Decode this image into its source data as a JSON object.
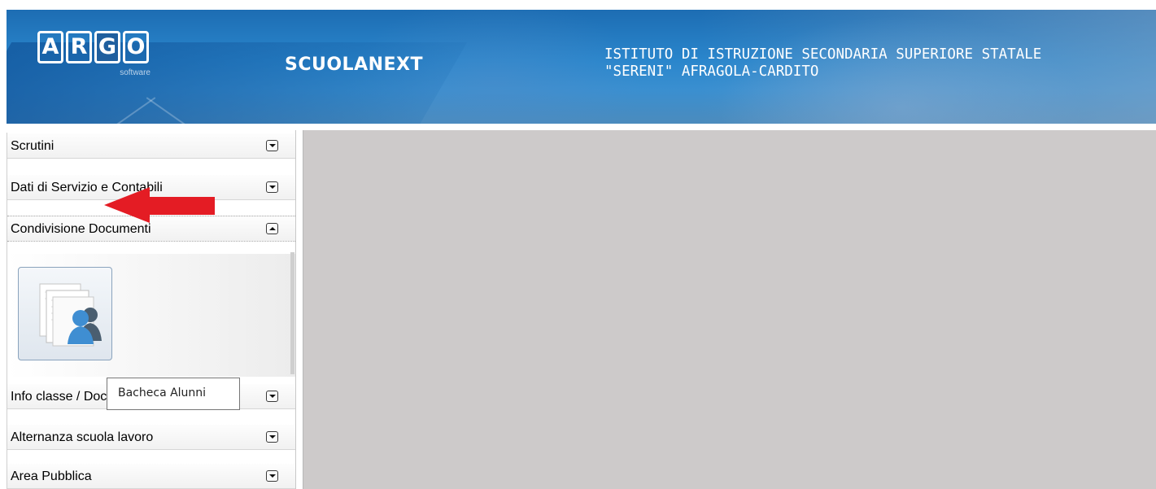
{
  "header": {
    "logo_letters": [
      "A",
      "R",
      "G",
      "O"
    ],
    "logo_subtitle": "software",
    "product_name": "SCUOLANEXT",
    "school_name": "ISTITUTO DI ISTRUZIONE SECONDARIA SUPERIORE STATALE \"SERENI\" AFRAGOLA-CARDITO",
    "banner_color": "#2a86cc"
  },
  "sidebar": {
    "items": [
      {
        "label": "Scrutini",
        "state": "collapsed"
      },
      {
        "label": "Dati di Servizio e Contabili",
        "state": "collapsed"
      },
      {
        "label": "Condivisione Documenti",
        "state": "expanded"
      },
      {
        "label": "Info classe / Docenti",
        "state": "collapsed"
      },
      {
        "label": "Alternanza scuola lavoro",
        "state": "collapsed"
      },
      {
        "label": "Area Pubblica",
        "state": "collapsed"
      }
    ],
    "panel_button": {
      "icon": "shared-documents-users-icon"
    },
    "tooltip": "Bacheca Alunni",
    "arrow_color": "#e41c24"
  },
  "content": {
    "background": "#cdcaca"
  }
}
